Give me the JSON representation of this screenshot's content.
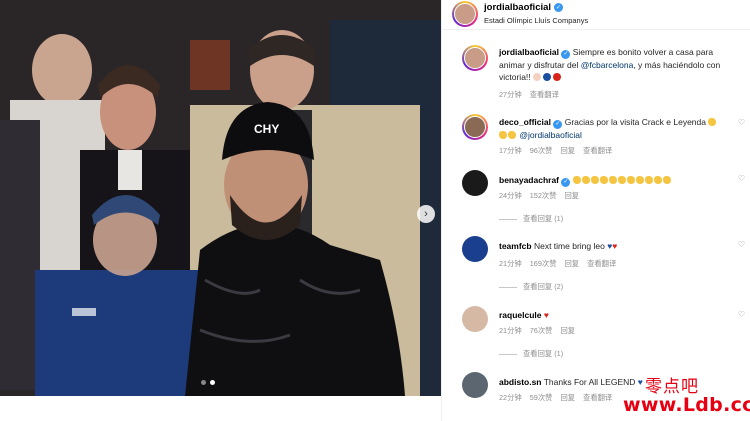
{
  "header": {
    "username": "jordialbaoficial",
    "location": "Estadi Olímpic Lluís Companys"
  },
  "photo": {
    "beanie_text": "CHY",
    "carousel_total": 2,
    "carousel_active": 2
  },
  "comments": [
    {
      "username": "jordialbaoficial",
      "verified": true,
      "text_before": "Siempre es bonito volver a casa para animar y disfrutar del ",
      "mention": "@fcbarcelona",
      "text_after": ", y más haciéndolo con victoria!! ",
      "time": "27分钟",
      "likes": "",
      "reply": "",
      "translate": "查看翻译"
    },
    {
      "username": "deco_official",
      "verified": true,
      "text_before": "Gracias por la visita Crack e Leyenda ",
      "mention": "@jordialbaoficial",
      "text_after": "",
      "time": "17分钟",
      "likes": "96次赞",
      "reply": "回复",
      "translate": "查看翻译"
    },
    {
      "username": "benayadachraf",
      "verified": true,
      "text_before": "",
      "mention": "",
      "text_after": "",
      "time": "24分钟",
      "likes": "152次赞",
      "reply": "回复",
      "translate": "",
      "view_replies": "查看回复 (1)"
    },
    {
      "username": "teamfcb",
      "verified": false,
      "text_before": "Next time bring leo ",
      "mention": "",
      "text_after": "",
      "time": "21分钟",
      "likes": "169次赞",
      "reply": "回复",
      "translate": "查看翻译",
      "view_replies": "查看回复 (2)"
    },
    {
      "username": "raquelcule",
      "verified": false,
      "text_before": "",
      "mention": "",
      "text_after": "",
      "time": "21分钟",
      "likes": "76次赞",
      "reply": "回复",
      "translate": "",
      "view_replies": "查看回复 (1)"
    },
    {
      "username": "abdisto.sn",
      "verified": false,
      "text_before": "Thanks For All LEGEND ",
      "mention": "",
      "text_after": "",
      "time": "22分钟",
      "likes": "59次赞",
      "reply": "回复",
      "translate": "查看翻译"
    }
  ],
  "watermark": {
    "chinese": "零点吧",
    "url": "www.Ldb.cc"
  },
  "colors": {
    "verified_blue": "#3897f0",
    "mention_blue": "#00376b",
    "meta_gray": "#8e8e8e",
    "watermark_red": "#e60012"
  },
  "icons": [
    "verified-badge-icon",
    "heart-icon",
    "chevron-right-icon",
    "clap-emoji-icon",
    "heart-emoji-icon"
  ]
}
